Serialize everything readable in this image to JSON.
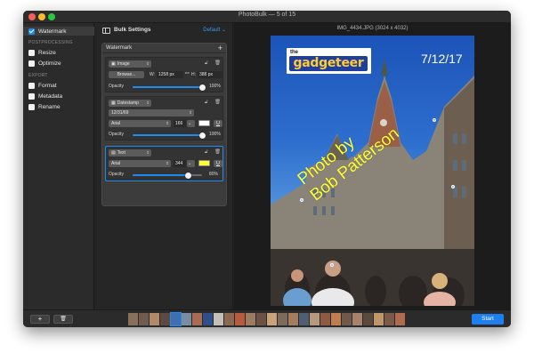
{
  "window": {
    "title": "PhotoBulk — 5 of 15"
  },
  "sidebar": {
    "watermark": {
      "label": "Watermark",
      "checked": true
    },
    "postprocessing_header": "POSTPROCESSING",
    "resize": {
      "label": "Resize",
      "checked": false
    },
    "optimize": {
      "label": "Optimize",
      "checked": false
    },
    "export_header": "EXPORT",
    "format": {
      "label": "Format",
      "checked": false
    },
    "metadata": {
      "label": "Metadata",
      "checked": false
    },
    "rename": {
      "label": "Rename",
      "checked": false
    }
  },
  "settings": {
    "title": "Bulk Settings",
    "preset": "Default",
    "watermark_label": "Watermark",
    "image_layer": {
      "type": "Image",
      "browse_label": "Browse...",
      "w_label": "W:",
      "w_value": "1258 px",
      "h_label": "H:",
      "h_value": "388 px",
      "opacity_label": "Opacity",
      "opacity_value": "100%",
      "opacity_fraction": 1.0
    },
    "datestamp_layer": {
      "type": "Datestamp",
      "format": "12/31/69",
      "font": "Arial",
      "size": "166",
      "color": "#ffffff",
      "opacity_label": "Opacity",
      "opacity_value": "100%",
      "opacity_fraction": 1.0
    },
    "text_layer": {
      "type": "Text",
      "font": "Arial",
      "size": "344",
      "color": "#ffff33",
      "opacity_label": "Opacity",
      "opacity_value": "80%",
      "opacity_fraction": 0.8
    }
  },
  "preview": {
    "image_info": "IMG_4434.JPG (3024 x 4032)",
    "logo_small": "the",
    "logo_main": "gadgeteer",
    "date_stamp": "7/12/17",
    "watermark_text": "Photo by\nBob Patterson"
  },
  "bottom": {
    "add_label": "+",
    "delete_icon": "trash-icon",
    "start_label": "Start"
  }
}
